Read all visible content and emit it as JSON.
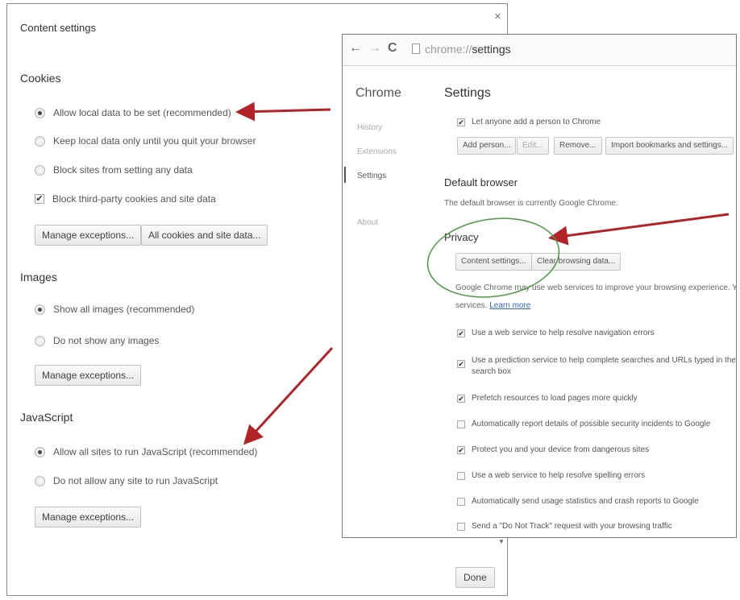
{
  "dialog": {
    "title": "Content settings",
    "close_glyph": "×",
    "cookies": {
      "title": "Cookies",
      "options": [
        "Allow local data to be set (recommended)",
        "Keep local data only until you quit your browser",
        "Block sites from setting any data"
      ],
      "selected": 0,
      "third_party_label": "Block third-party cookies and site data",
      "third_party_checked": true,
      "manage_button": "Manage exceptions...",
      "all_cookies_button": "All cookies and site data..."
    },
    "images": {
      "title": "Images",
      "options": [
        "Show all images (recommended)",
        "Do not show any images"
      ],
      "selected": 0,
      "manage_button": "Manage exceptions..."
    },
    "javascript": {
      "title": "JavaScript",
      "options": [
        "Allow all sites to run JavaScript (recommended)",
        "Do not allow any site to run JavaScript"
      ],
      "selected": 0,
      "manage_button": "Manage exceptions..."
    },
    "done_button": "Done"
  },
  "chrome": {
    "url_scheme": "chrome://",
    "url_page": "settings",
    "sidebar": {
      "title": "Chrome",
      "items": [
        "History",
        "Extensions",
        "Settings",
        "About"
      ],
      "active": 2
    },
    "settings_title": "Settings",
    "people": {
      "let_anyone_label": "Let anyone add a person to Chrome",
      "buttons": [
        "Add person...",
        "Edit...",
        "Remove...",
        "Import bookmarks and settings..."
      ]
    },
    "default_browser": {
      "title": "Default browser",
      "text": "The default browser is currently Google Chrome."
    },
    "privacy": {
      "title": "Privacy",
      "content_settings_button": "Content settings...",
      "clear_browsing_button": "Clear browsing data...",
      "description": "Google Chrome may use web services to improve your browsing experience. You",
      "description2": "services.",
      "learn_more": "Learn more",
      "options": [
        {
          "label": "Use a web service to help resolve navigation errors",
          "checked": true
        },
        {
          "label": "Use a prediction service to help complete searches and URLs typed in the add",
          "label2": "search box",
          "checked": true
        },
        {
          "label": "Prefetch resources to load pages more quickly",
          "checked": true
        },
        {
          "label": "Automatically report details of possible security incidents to Google",
          "checked": false
        },
        {
          "label": "Protect you and your device from dangerous sites",
          "checked": true
        },
        {
          "label": "Use a web service to help resolve spelling errors",
          "checked": false
        },
        {
          "label": "Automatically send usage statistics and crash reports to Google",
          "checked": false
        },
        {
          "label": "Send a \"Do Not Track\" request with your browsing traffic",
          "checked": false
        }
      ]
    }
  },
  "colors": {
    "arrow": "#b32227",
    "highlight_circle": "#4a9a44",
    "link": "#3366cc"
  }
}
